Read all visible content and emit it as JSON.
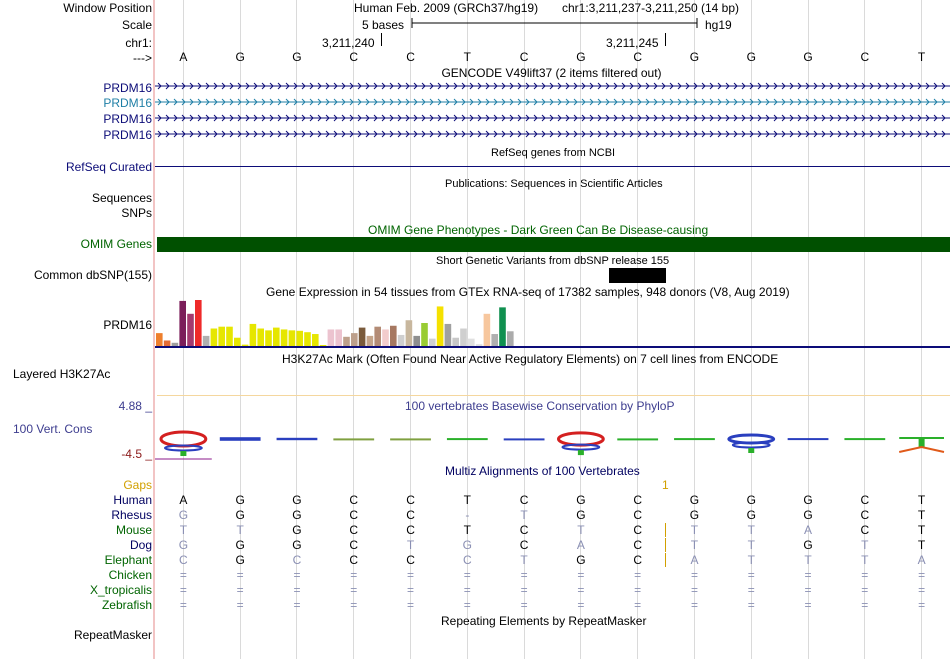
{
  "labels": {
    "window_position": "Window Position",
    "scale": "Scale",
    "chrom": "chr1:",
    "strand": "--->",
    "prdm16_rows": [
      "PRDM16",
      "PRDM16",
      "PRDM16",
      "PRDM16"
    ],
    "refseq": "RefSeq Curated",
    "sequences": "Sequences",
    "snps": "SNPs",
    "omim": "OMIM Genes",
    "dbsnp": "Common dbSNP(155)",
    "gtex_gene": "PRDM16",
    "h3k27ac": "Layered H3K27Ac",
    "cons_max": "4.88 _",
    "cons_name": "100 Vert. Cons",
    "cons_min": "-4.5 _",
    "repeatmasker": "RepeatMasker"
  },
  "header": {
    "assembly": "Human Feb. 2009 (GRCh37/hg19)",
    "position": "chr1:3,211,237-3,211,250 (14 bp)",
    "scale_text": "5 bases",
    "scale_db": "hg19",
    "coord_1": "3,211,240",
    "coord_2": "3,211,245"
  },
  "bases": [
    "A",
    "G",
    "G",
    "C",
    "C",
    "T",
    "C",
    "G",
    "C",
    "G",
    "G",
    "G",
    "C",
    "T"
  ],
  "tracks": {
    "gencode": "GENCODE V49lift37 (2 items filtered out)",
    "refseq": "RefSeq genes from NCBI",
    "publications": "Publications: Sequences in Scientific Articles",
    "omim": "OMIM Gene Phenotypes - Dark Green Can Be Disease-causing",
    "dbsnp": "Short Genetic Variants from dbSNP release 155",
    "gtex": "Gene Expression in 54 tissues from GTEx RNA-seq of 17382 samples, 948 donors (V8, Aug 2019)",
    "h3k27ac": "H3K27Ac Mark (Often Found Near Active Regulatory Elements) on 7 cell lines from ENCODE",
    "phylop": "100 vertebrates Basewise Conservation by PhyloP",
    "multiz": "Multiz Alignments of 100 Vertebrates",
    "repeatmasker": "Repeating Elements by RepeatMasker"
  },
  "colors": {
    "gene": "#0c0c78",
    "gene_alt": "#1f7fa6",
    "omim_bar": "#005000",
    "omim_label": "#006400",
    "gaps": "#d2a000",
    "blue_label": "#3d3d8f",
    "cons_min": "#8b1a1a",
    "green_species": "#006400",
    "separator": "#f2c4c4",
    "gridline": "#dadada"
  },
  "gtex": [
    {
      "value": 0.28,
      "color": "#ee7f2d"
    },
    {
      "value": 0.12,
      "color": "#e36c34"
    },
    {
      "value": 0.07,
      "color": "#9f9f9f"
    },
    {
      "value": 0.98,
      "color": "#7b1e5a"
    },
    {
      "value": 0.7,
      "color": "#a33a6f"
    },
    {
      "value": 1.0,
      "color": "#ee2a2a"
    },
    {
      "value": 0.22,
      "color": "#b0b0b0"
    },
    {
      "value": 0.38,
      "color": "#e6e600"
    },
    {
      "value": 0.42,
      "color": "#e6e600"
    },
    {
      "value": 0.42,
      "color": "#e6e600"
    },
    {
      "value": 0.18,
      "color": "#e6e600"
    },
    {
      "value": 0.03,
      "color": "#e6e600"
    },
    {
      "value": 0.48,
      "color": "#e6e600"
    },
    {
      "value": 0.38,
      "color": "#e6e600"
    },
    {
      "value": 0.34,
      "color": "#e6e600"
    },
    {
      "value": 0.4,
      "color": "#e6e600"
    },
    {
      "value": 0.36,
      "color": "#e6e600"
    },
    {
      "value": 0.34,
      "color": "#e6e600"
    },
    {
      "value": 0.33,
      "color": "#e6e600"
    },
    {
      "value": 0.3,
      "color": "#e6e600"
    },
    {
      "value": 0.26,
      "color": "#e6e600"
    },
    {
      "value": 0.02,
      "color": "#e6e600"
    },
    {
      "value": 0.36,
      "color": "#ecc3cf"
    },
    {
      "value": 0.36,
      "color": "#ecc3cf"
    },
    {
      "value": 0.2,
      "color": "#bda08b"
    },
    {
      "value": 0.28,
      "color": "#bda08b"
    },
    {
      "value": 0.4,
      "color": "#7a5a3b"
    },
    {
      "value": 0.22,
      "color": "#c4a48a"
    },
    {
      "value": 0.42,
      "color": "#b38b75"
    },
    {
      "value": 0.36,
      "color": "#f2cccc"
    },
    {
      "value": 0.44,
      "color": "#a67861"
    },
    {
      "value": 0.24,
      "color": "#cfcfcf"
    },
    {
      "value": 0.56,
      "color": "#c8b79e"
    },
    {
      "value": 0.22,
      "color": "#8f8f8f"
    },
    {
      "value": 0.5,
      "color": "#99cc33"
    },
    {
      "value": 0.16,
      "color": "#d0d0d0"
    },
    {
      "value": 0.86,
      "color": "#f5e100"
    },
    {
      "value": 0.48,
      "color": "#a0a0a0"
    },
    {
      "value": 0.18,
      "color": "#c8c8c8"
    },
    {
      "value": 0.38,
      "color": "#cfcfcf"
    },
    {
      "value": 0.16,
      "color": "#e0e0e0"
    },
    {
      "value": 0.04,
      "color": "#e0e0e0"
    },
    {
      "value": 0.7,
      "color": "#f7c79e"
    },
    {
      "value": 0.26,
      "color": "#b0b0b0"
    },
    {
      "value": 0.84,
      "color": "#109050"
    },
    {
      "value": 0.32,
      "color": "#ababab"
    }
  ],
  "alignment": {
    "gaps_label": "Gaps",
    "gap_count": "1",
    "rows": [
      {
        "species": "Human",
        "color": "#000060",
        "cells": [
          "A",
          "G",
          "G",
          "C",
          "C",
          "T",
          "C",
          "G",
          "C",
          "G",
          "G",
          "G",
          "C",
          "T"
        ],
        "match": [
          1,
          1,
          1,
          1,
          1,
          1,
          1,
          1,
          1,
          1,
          1,
          1,
          1,
          1
        ]
      },
      {
        "species": "Rhesus",
        "color": "#000060",
        "cells": [
          "G",
          "G",
          "G",
          "C",
          "C",
          "-",
          "T",
          "G",
          "C",
          "G",
          "G",
          "G",
          "C",
          "T"
        ],
        "match": [
          0,
          1,
          1,
          1,
          1,
          0,
          0,
          1,
          1,
          1,
          1,
          1,
          1,
          1
        ]
      },
      {
        "species": "Mouse",
        "color": "#006400",
        "cells": [
          "T",
          "T",
          "G",
          "C",
          "C",
          "T",
          "C",
          "T",
          "C",
          "T",
          "T",
          "A",
          "C",
          "T"
        ],
        "match": [
          0,
          0,
          1,
          1,
          1,
          1,
          1,
          0,
          1,
          0,
          0,
          0,
          1,
          1
        ]
      },
      {
        "species": "Dog",
        "color": "#000060",
        "cells": [
          "G",
          "G",
          "G",
          "C",
          "T",
          "G",
          "C",
          "A",
          "C",
          "T",
          "T",
          "G",
          "T",
          "T"
        ],
        "match": [
          0,
          1,
          1,
          1,
          0,
          0,
          1,
          0,
          1,
          0,
          0,
          1,
          0,
          1
        ]
      },
      {
        "species": "Elephant",
        "color": "#006400",
        "cells": [
          "C",
          "G",
          "C",
          "C",
          "C",
          "C",
          "T",
          "G",
          "C",
          "A",
          "T",
          "T",
          "T",
          "A"
        ],
        "match": [
          0,
          1,
          0,
          1,
          1,
          0,
          0,
          1,
          1,
          0,
          0,
          0,
          0,
          0
        ]
      },
      {
        "species": "Chicken",
        "color": "#006400",
        "cells": [
          "=",
          "=",
          "=",
          "=",
          "=",
          "=",
          "=",
          "=",
          "=",
          "=",
          "=",
          "=",
          "=",
          "="
        ],
        "match": [
          0,
          0,
          0,
          0,
          0,
          0,
          0,
          0,
          0,
          0,
          0,
          0,
          0,
          0
        ]
      },
      {
        "species": "X_tropicalis",
        "color": "#006400",
        "cells": [
          "=",
          "=",
          "=",
          "=",
          "=",
          "=",
          "=",
          "=",
          "=",
          "=",
          "=",
          "=",
          "=",
          "="
        ],
        "match": [
          0,
          0,
          0,
          0,
          0,
          0,
          0,
          0,
          0,
          0,
          0,
          0,
          0,
          0
        ]
      },
      {
        "species": "Zebrafish",
        "color": "#006400",
        "cells": [
          "=",
          "=",
          "=",
          "=",
          "=",
          "=",
          "=",
          "=",
          "=",
          "=",
          "=",
          "=",
          "=",
          "="
        ],
        "match": [
          0,
          0,
          0,
          0,
          0,
          0,
          0,
          0,
          0,
          0,
          0,
          0,
          0,
          0
        ]
      }
    ]
  },
  "phylop": [
    {
      "kind": "logo",
      "height": 1.0,
      "color": "#d42020"
    },
    {
      "kind": "bar",
      "height": 0.3,
      "color": "#2a3fbf"
    },
    {
      "kind": "bar",
      "height": 0.2,
      "color": "#2a3fbf"
    },
    {
      "kind": "bar",
      "height": 0.1,
      "color": "#7fa040"
    },
    {
      "kind": "bar",
      "height": 0.1,
      "color": "#7fa040"
    },
    {
      "kind": "bar",
      "height": 0.15,
      "color": "#2ab02a"
    },
    {
      "kind": "bar",
      "height": 0.1,
      "color": "#2a3fbf"
    },
    {
      "kind": "logo",
      "height": 0.85,
      "color": "#d42020"
    },
    {
      "kind": "bar",
      "height": 0.1,
      "color": "#2ab02a"
    },
    {
      "kind": "bar",
      "height": 0.15,
      "color": "#2ab02a"
    },
    {
      "kind": "logo2",
      "height": 0.5,
      "color": "#2a3fbf"
    },
    {
      "kind": "bar",
      "height": 0.15,
      "color": "#2a3fbf"
    },
    {
      "kind": "bar",
      "height": 0.15,
      "color": "#2ab02a"
    },
    {
      "kind": "tee",
      "height": 0.55,
      "color": "#2ab02a"
    }
  ]
}
